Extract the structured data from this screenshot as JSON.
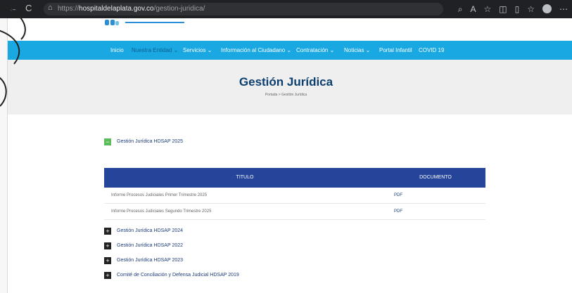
{
  "browser": {
    "back": "←",
    "reload": "C",
    "lock": "⌂",
    "url_scheme": "https://",
    "url_host": "hospitaldelaplata.gov.co",
    "url_path": "/gestion-juridica/",
    "icons": [
      "search-icon",
      "read-aloud-icon",
      "favorite-icon",
      "extensions-icon",
      "split-icon",
      "collections-icon",
      "profile-icon",
      "more-icon"
    ]
  },
  "nav": {
    "items": [
      {
        "label": "Inicio"
      },
      {
        "label": "Nuestra Entidad ⌄"
      },
      {
        "label": "Servicios ⌄"
      },
      {
        "label": "Información al Ciudadano ⌄"
      },
      {
        "label": "Contratación ⌄"
      },
      {
        "label": "Noticias ⌄"
      },
      {
        "label": "Portal Infantil"
      },
      {
        "label": "COVID 19"
      }
    ]
  },
  "hero": {
    "title": "Gestión Jurídica",
    "breadcrumb": "Portada > Gestión Jurídica"
  },
  "accordion": {
    "open": {
      "icon": "−",
      "label": "Gestión Jurídica HDSAP 2025"
    },
    "closed": [
      {
        "icon": "+",
        "label": "Gestión Jurídica HDSAP 2024"
      },
      {
        "icon": "+",
        "label": "Gestión Jurídica HDSAP 2022"
      },
      {
        "icon": "+",
        "label": "Gestión Jurídica HDSAP 2023"
      },
      {
        "icon": "+",
        "label": "Comité de Conciliación y Defensa Judicial HDSAP 2019"
      }
    ]
  },
  "table": {
    "col_title": "TITULO",
    "col_doc": "DOCUMENTO",
    "rows": [
      {
        "title": "Informe Procesos Judiciales Primer Trimestre 2025",
        "doc": "PDF"
      },
      {
        "title": "Informe Procesos Judiciales Segundo Trimestre 2025",
        "doc": "PDF"
      }
    ]
  },
  "colors": {
    "nav_bg": "#1aa8e2",
    "table_head": "#25459a",
    "title": "#0c3f6f",
    "open_icon": "#5cbc5a"
  }
}
